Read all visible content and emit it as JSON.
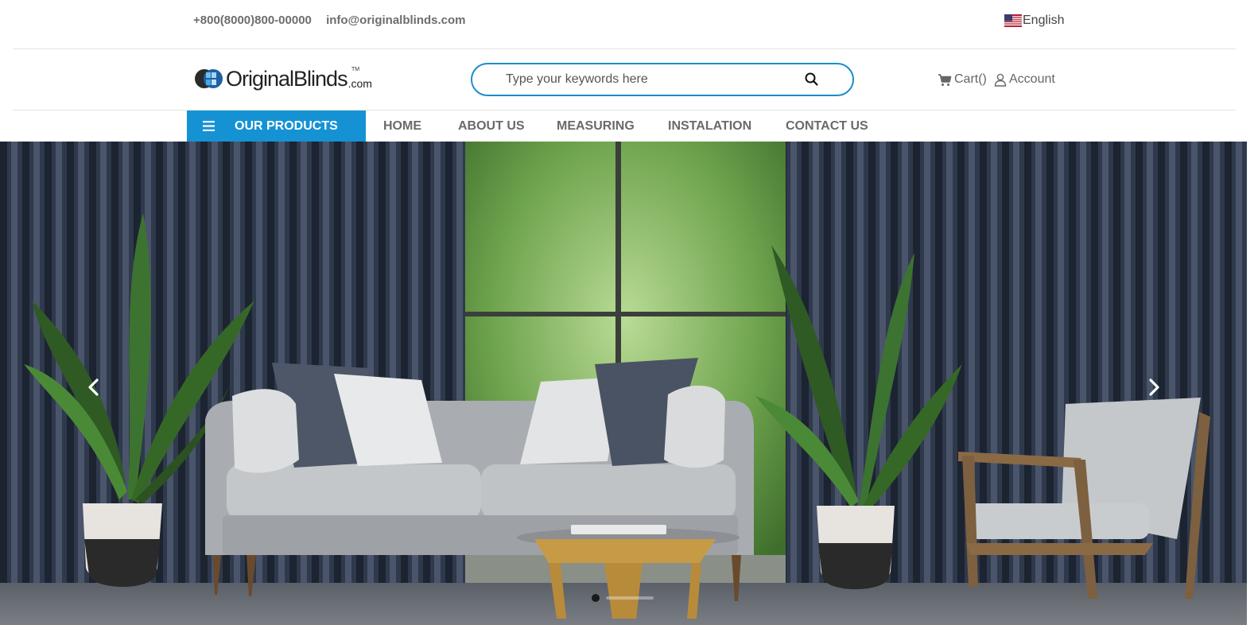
{
  "topbar": {
    "phone": "+800(8000)800-00000",
    "email": "info@originalblinds.com",
    "language": "English",
    "language_flag": "us-flag-icon"
  },
  "header": {
    "logo_text": "OriginalBlinds",
    "logo_suffix": ".com",
    "logo_tm": "TM",
    "search_placeholder": "Type your keywords here",
    "search_value": "",
    "cart_label": "Cart()",
    "account_label": "Account"
  },
  "nav": {
    "products_label": "OUR PRODUCTS",
    "items": [
      "HOME",
      "ABOUT US",
      "MEASURING",
      "INSTALATION",
      "CONTACT US"
    ]
  },
  "hero": {
    "slide_count": 1,
    "active_slide": 1
  },
  "colors": {
    "accent": "#1592d4",
    "search_border": "#1a8ec9",
    "text": "#6d6d6d"
  },
  "icons": {
    "search": "search-icon",
    "cart": "cart-icon",
    "account": "user-icon",
    "menu": "hamburger-icon",
    "prev": "chevron-left-icon",
    "next": "chevron-right-icon"
  }
}
